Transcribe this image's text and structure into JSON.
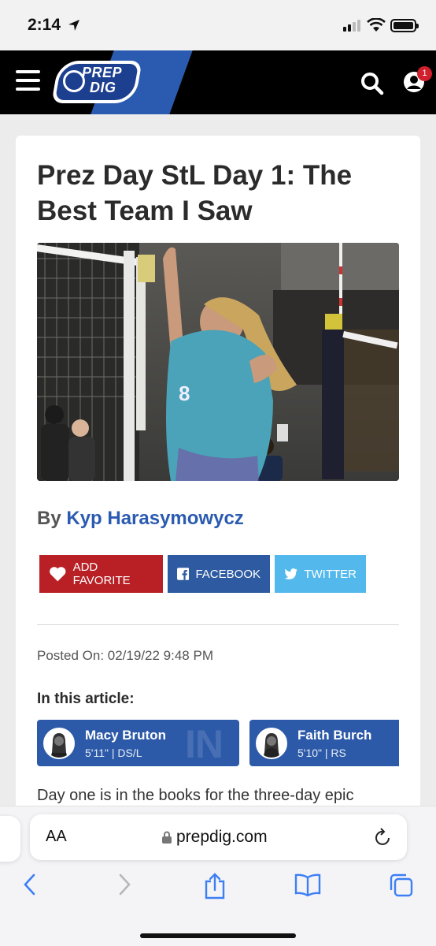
{
  "status_bar": {
    "time": "2:14"
  },
  "header": {
    "logo_line1": "PREP",
    "logo_line2": "DIG",
    "notification_count": "1"
  },
  "article": {
    "title": "Prez Day StL Day 1: The Best Team I Saw",
    "byline_prefix": "By",
    "author": "Kyp Harasymowycz",
    "share": {
      "favorite": "ADD FAVORITE",
      "facebook": "FACEBOOK",
      "twitter": "TWITTER"
    },
    "posted": "Posted On: 02/19/22 9:48 PM",
    "in_article_label": "In this article:",
    "players": [
      {
        "name": "Macy Bruton",
        "meta": "5'11\" | DS/L",
        "watermark": "IN"
      },
      {
        "name": "Faith Burch",
        "meta": "5'10\" | RS"
      }
    ],
    "body_start": "Day one is in the books for the three-day epic"
  },
  "browser": {
    "text_size": "AA",
    "url": "prepdig.com"
  },
  "colors": {
    "brand_blue": "#2b5bb0",
    "favorite_red": "#b82025",
    "facebook_blue": "#2d5aa0",
    "twitter_blue": "#53b9ec"
  },
  "icons": [
    "location-arrow-icon",
    "signal-icon",
    "wifi-icon",
    "battery-icon",
    "menu-icon",
    "search-icon",
    "user-icon",
    "heart-icon",
    "facebook-icon",
    "twitter-icon",
    "lock-icon",
    "reload-icon",
    "back-icon",
    "forward-icon",
    "share-icon",
    "bookmarks-icon",
    "tabs-icon"
  ]
}
